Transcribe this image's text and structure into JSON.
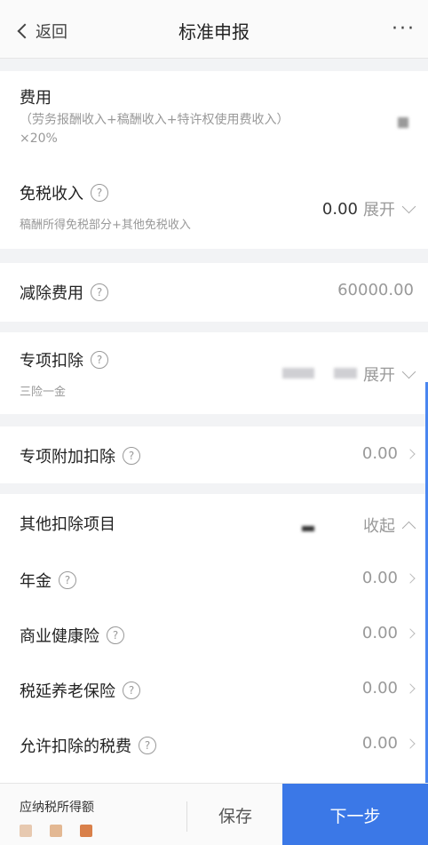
{
  "header": {
    "back_label": "返回",
    "title": "标准申报",
    "more": "···"
  },
  "fee": {
    "label": "费用",
    "formula": "（劳务报酬收入+稿酬收入+特许权使用费收入）",
    "rate": "×20%"
  },
  "tax_free_income": {
    "label": "免税收入",
    "sub": "稿酬所得免税部分+其他免税收入",
    "value": "0.00",
    "action": "展开"
  },
  "deduction_fee": {
    "label": "减除费用",
    "value": "60000.00"
  },
  "special_deduction": {
    "label": "专项扣除",
    "sub": "三险一金",
    "action": "展开"
  },
  "special_additional": {
    "label": "专项附加扣除",
    "value": "0.00"
  },
  "other_deductions": {
    "label": "其他扣除项目",
    "action": "收起"
  },
  "other_items": [
    {
      "label": "年金",
      "value": "0.00"
    },
    {
      "label": "商业健康险",
      "value": "0.00"
    },
    {
      "label": "税延养老保险",
      "value": "0.00"
    },
    {
      "label": "允许扣除的税费",
      "value": "0.00"
    }
  ],
  "footer": {
    "taxable_label": "应纳税所得额",
    "save": "保存",
    "next": "下一步"
  },
  "icons": {
    "help": "?"
  },
  "colors": {
    "primary": "#3b78e7",
    "dots": [
      "#e7c9b0",
      "#e3b893",
      "#d9804a"
    ]
  }
}
